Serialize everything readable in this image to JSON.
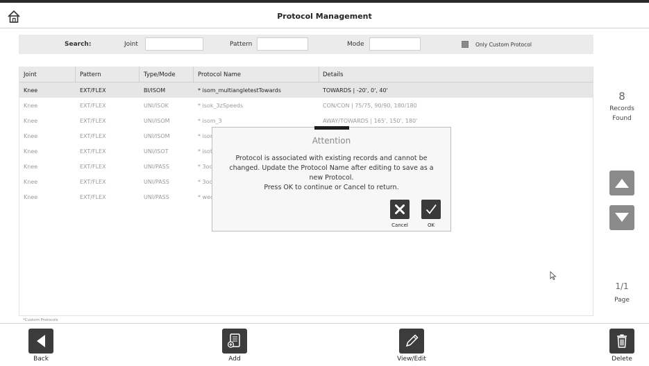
{
  "header": {
    "title": "Protocol Management"
  },
  "search": {
    "label": "Search:",
    "joint_label": "Joint",
    "joint_value": "",
    "pattern_label": "Pattern",
    "pattern_value": "",
    "mode_label": "Mode",
    "mode_value": "",
    "only_custom_label": "Only Custom Protocol"
  },
  "table": {
    "columns": [
      "Joint",
      "Pattern",
      "Type/Mode",
      "Protocol Name",
      "Details"
    ],
    "rows": [
      [
        "Knee",
        "EXT/FLEX",
        "BI/ISOM",
        "* isom_multiangletestTowards",
        "TOWARDS |  -20', 0', 40'"
      ],
      [
        "Knee",
        "EXT/FLEX",
        "UNI/ISOK",
        "* isok_3zSpeeds",
        "CON/CON |  75/75, 90/90, 180/180"
      ],
      [
        "Knee",
        "EXT/FLEX",
        "UNI/ISOM",
        "* isom_3",
        "AWAY/TOWARDS |  165', 150', 180'"
      ],
      [
        "Knee",
        "EXT/FLEX",
        "UNI/ISOM",
        "* isor",
        ""
      ],
      [
        "Knee",
        "EXT/FLEX",
        "UNI/ISOT",
        "* isot",
        ""
      ],
      [
        "Knee",
        "EXT/FLEX",
        "UNI/PASS",
        "* 3oc",
        ""
      ],
      [
        "Knee",
        "EXT/FLEX",
        "UNI/PASS",
        "* 3oc",
        ""
      ],
      [
        "Knee",
        "EXT/FLEX",
        "UNI/PASS",
        "* wec",
        ""
      ]
    ],
    "footnote": "*Custom Protocols"
  },
  "records": {
    "count": "8",
    "label_line1": "Records",
    "label_line2": "Found"
  },
  "pagination": {
    "page": "1/1",
    "label": "Page"
  },
  "toolbar": {
    "back": "Back",
    "add": "Add",
    "view_edit": "View/Edit",
    "delete": "Delete"
  },
  "dialog": {
    "title": "Attention",
    "lines": [
      "Protocol is associated with existing records and cannot be",
      "changed. Update the Protocol Name after editing to save as a",
      "new Protocol.",
      "Press OK to continue or Cancel to return."
    ],
    "cancel_label": "Cancel",
    "ok_label": "OK"
  }
}
